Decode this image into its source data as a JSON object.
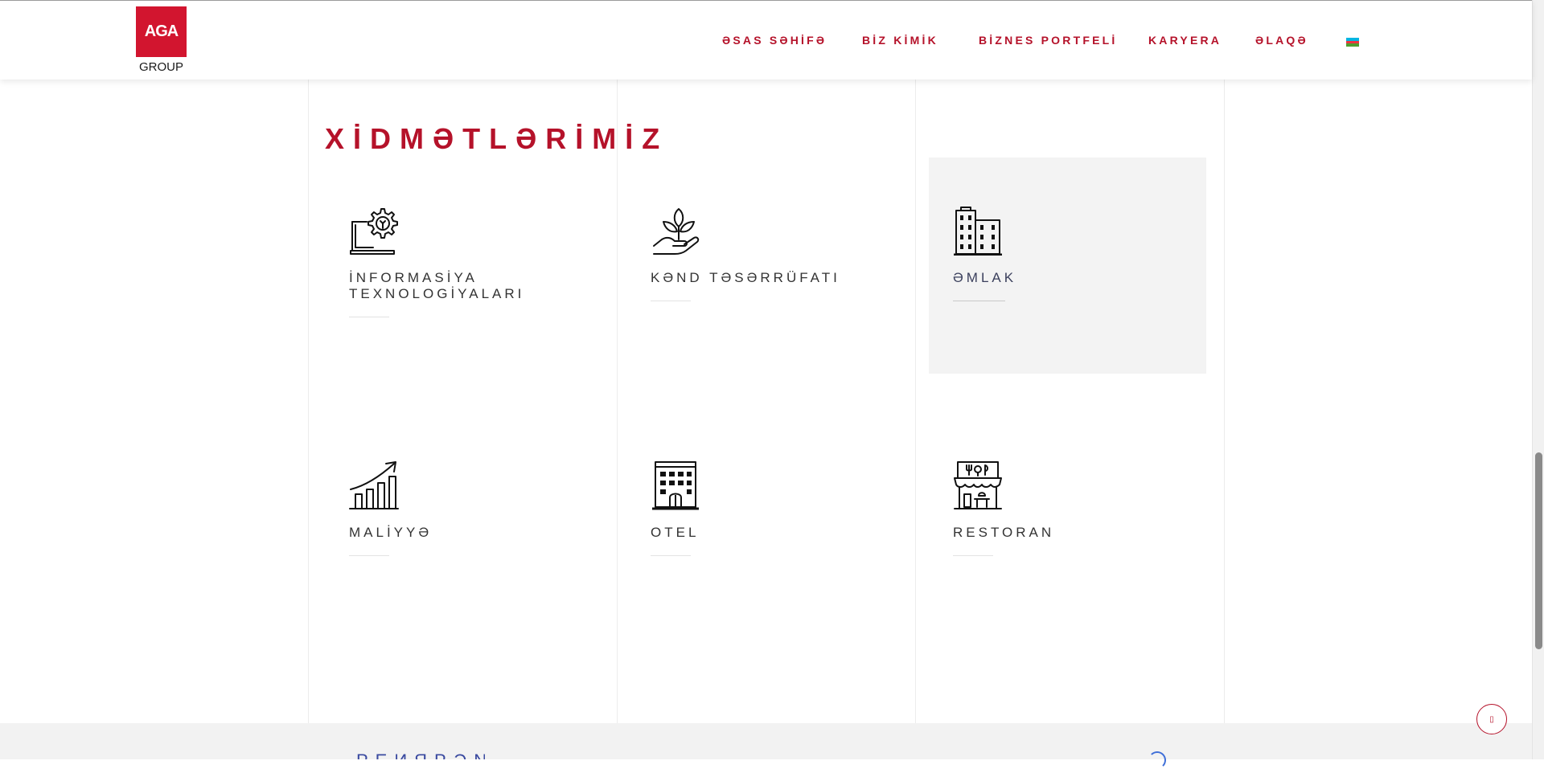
{
  "header": {
    "logo": {
      "box_text": "AGA",
      "sub_text": "GROUP"
    },
    "nav": [
      {
        "label": "ƏSAS SƏHİFƏ"
      },
      {
        "label": "BİZ KİMİK"
      },
      {
        "label": "BİZNES PORTFELİ"
      },
      {
        "label": "KARYERA"
      },
      {
        "label": "ƏLAQƏ"
      }
    ],
    "language_flag": {
      "icon": "azerbaijan-flag-icon",
      "colors": [
        "#00b5e2",
        "#ef3340",
        "#509e2f"
      ]
    }
  },
  "services": {
    "title": "XİDMƏTLƏRİMİZ",
    "items": [
      {
        "label": "İNFORMASİYA TEXNOLOGİYALARI",
        "icon": "laptop-gear-icon"
      },
      {
        "label": "KƏND TƏSƏRRÜFATI",
        "icon": "hand-plant-icon"
      },
      {
        "label": "ƏMLAK",
        "icon": "buildings-icon"
      },
      {
        "label": "MALİYYƏ",
        "icon": "growth-chart-icon"
      },
      {
        "label": "OTEL",
        "icon": "hotel-icon"
      },
      {
        "label": "RESTORAN",
        "icon": "restaurant-icon"
      }
    ]
  },
  "footer": {
    "peek_text": "PEИЯPƏN"
  },
  "scroll_top": {
    "icon": "arrow-up-icon",
    "label": ""
  },
  "colors": {
    "brand_red": "#d2152f",
    "nav_red": "#b5122a",
    "highlight_bg": "#f3f3f3"
  }
}
